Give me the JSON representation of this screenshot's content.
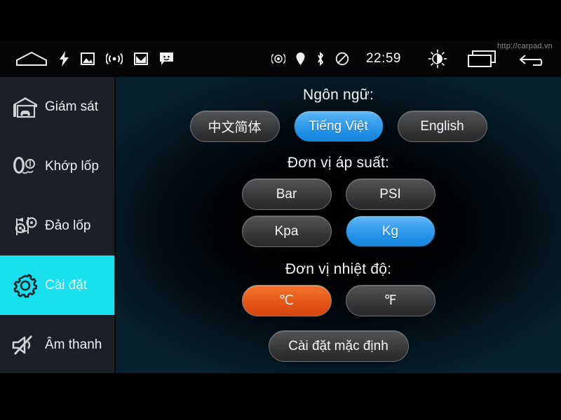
{
  "statusbar": {
    "left_icons": [
      {
        "name": "home-icon",
        "glyph": "home"
      },
      {
        "name": "lightning-icon",
        "glyph": "bolt"
      },
      {
        "name": "gallery-icon",
        "glyph": "image"
      },
      {
        "name": "wifi-icon",
        "glyph": "wifi"
      },
      {
        "name": "gmail-icon",
        "glyph": "mail"
      },
      {
        "name": "messages-icon",
        "glyph": "chat"
      }
    ],
    "right_icons": [
      {
        "name": "gps-signal-icon",
        "glyph": "radar"
      },
      {
        "name": "location-pin-icon",
        "glyph": "pin"
      },
      {
        "name": "bluetooth-icon",
        "glyph": "bluetooth"
      },
      {
        "name": "do-not-disturb-icon",
        "glyph": "dnd"
      }
    ],
    "time": "22:59",
    "nav_icons": [
      {
        "name": "brightness-icon",
        "glyph": "sun"
      },
      {
        "name": "recent-apps-icon",
        "glyph": "recents"
      },
      {
        "name": "back-icon",
        "glyph": "back"
      }
    ],
    "watermark": "http://carpad.vn"
  },
  "sidebar": {
    "items": [
      {
        "label": "Giám sát",
        "icon": "car-garage-icon",
        "active": false
      },
      {
        "label": "Khớp lốp",
        "icon": "tire-pair-icon",
        "active": false
      },
      {
        "label": "Đảo lốp",
        "icon": "tire-rotate-icon",
        "active": false
      },
      {
        "label": "Cài đặt",
        "icon": "gear-icon",
        "active": true
      },
      {
        "label": "Âm thanh",
        "icon": "speaker-mute-icon",
        "active": false
      }
    ],
    "active_color": "#18e0ee",
    "background": "#1b2026"
  },
  "settings": {
    "language": {
      "title": "Ngôn ngữ:",
      "options": [
        {
          "label": "中文简体",
          "selected": false
        },
        {
          "label": "Tiếng Việt",
          "selected": true
        },
        {
          "label": "English",
          "selected": false
        }
      ],
      "selected": "Tiếng Việt",
      "selected_color": "#1f8ee4"
    },
    "pressure_unit": {
      "title": "Đơn vị áp suất:",
      "options": [
        {
          "label": "Bar",
          "selected": false
        },
        {
          "label": "PSI",
          "selected": false
        },
        {
          "label": "Kpa",
          "selected": false
        },
        {
          "label": "Kg",
          "selected": true
        }
      ],
      "selected": "Kg",
      "selected_color": "#1f8ee4"
    },
    "temperature_unit": {
      "title": "Đơn vị nhiệt độ:",
      "options": [
        {
          "label": "℃",
          "selected": true
        },
        {
          "label": "℉",
          "selected": false
        }
      ],
      "selected": "℃",
      "selected_color": "#e85f1d"
    },
    "reset_button": "Cài đặt mặc định"
  }
}
